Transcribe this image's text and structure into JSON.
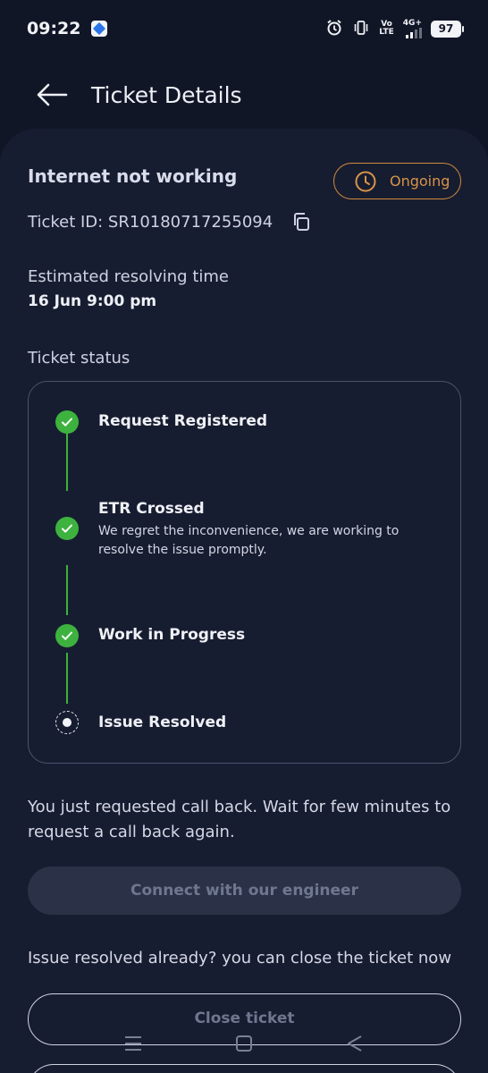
{
  "status_bar": {
    "time": "09:22",
    "volte": "Vo\nLTE",
    "network": "4G+",
    "battery": "97",
    "icons": [
      "app-icon",
      "alarm-icon",
      "vibrate-icon",
      "volte-icon",
      "signal-icon",
      "battery-icon"
    ]
  },
  "header": {
    "title": "Ticket Details",
    "back_icon": "arrow-left-icon"
  },
  "ticket": {
    "title": "Internet not working",
    "status": "Ongoing",
    "status_icon": "clock-icon",
    "id_text": "Ticket ID: SR10180717255094",
    "copy_icon": "copy-icon",
    "etr_label": "Estimated resolving time",
    "etr_value": "16 Jun 9:00 pm",
    "status_section_label": "Ticket status"
  },
  "timeline": {
    "steps": [
      {
        "title": "Request Registered",
        "desc": "",
        "state": "done"
      },
      {
        "title": "ETR Crossed",
        "desc": "We regret the inconvenience, we are working to resolve the issue promptly.",
        "state": "done"
      },
      {
        "title": "Work in Progress",
        "desc": "",
        "state": "done"
      },
      {
        "title": "Issue Resolved",
        "desc": "",
        "state": "pending"
      }
    ]
  },
  "callback": {
    "message": "You just requested call back. Wait for few minutes to request a call back again.",
    "button_label": "Connect with our engineer",
    "button_enabled": false
  },
  "close": {
    "message": "Issue resolved already? you can close the ticket now",
    "button_label": "Close ticket"
  },
  "nav": {
    "icons": [
      "menu-icon",
      "home-icon",
      "back-icon"
    ]
  },
  "colors": {
    "background": "#111627",
    "card": "#171d30",
    "accent_orange": "#d8934a",
    "success_green": "#3db23f",
    "border": "#4a5270",
    "disabled_button": "#2b3247"
  }
}
